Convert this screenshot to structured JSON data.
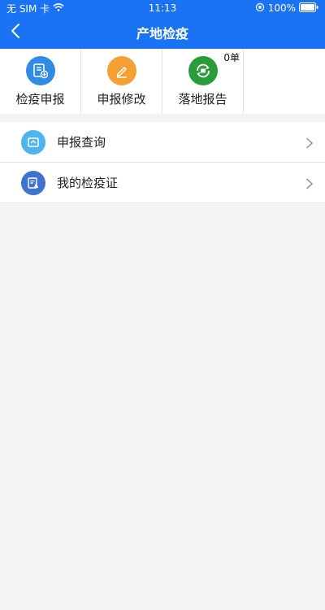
{
  "status_bar": {
    "carrier": "无 SIM 卡",
    "time": "11:13",
    "battery": "100%"
  },
  "header": {
    "title": "产地检疫",
    "back_icon": "back-arrow-icon"
  },
  "actions": [
    {
      "label": "检疫申报",
      "icon": "document-add-icon",
      "color": "#2f8be6"
    },
    {
      "label": "申报修改",
      "icon": "edit-pencil-icon",
      "color": "#f5a033"
    },
    {
      "label": "落地报告",
      "icon": "report-refresh-icon",
      "color": "#2a9d3a",
      "badge": "0单"
    }
  ],
  "list": [
    {
      "label": "申报查询",
      "icon": "query-icon",
      "color": "#4db4f0"
    },
    {
      "label": "我的检疫证",
      "icon": "certificate-icon",
      "color": "#3f73d1"
    }
  ],
  "colors": {
    "header_bg": "#1a73f4",
    "page_bg": "#f4f4f4"
  }
}
